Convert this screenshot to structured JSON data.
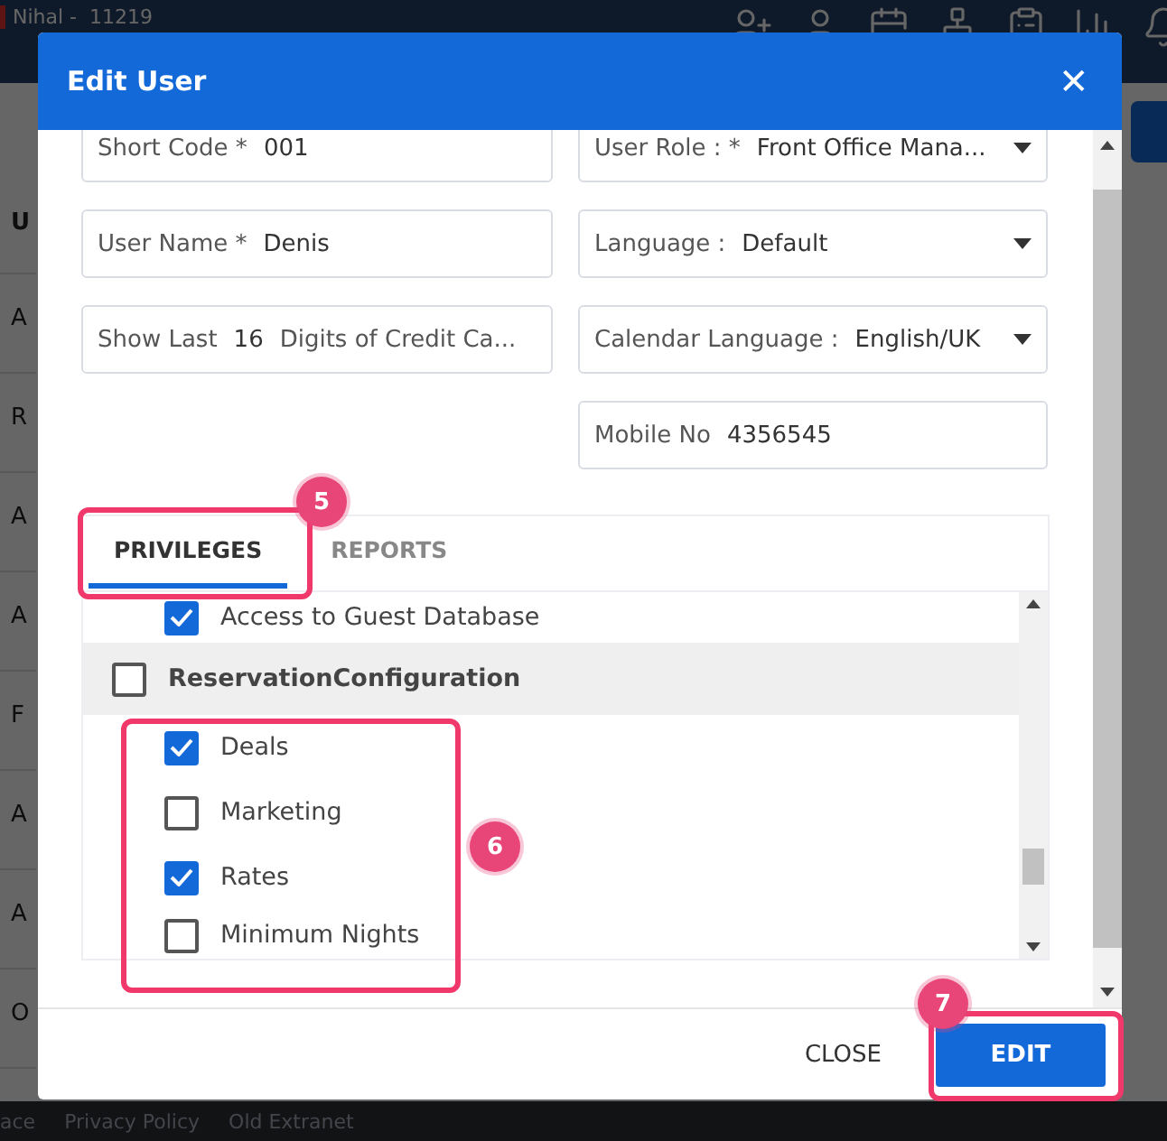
{
  "app": {
    "user": "Nihal -  11219",
    "column_header": "U",
    "row_fragments": [
      "A",
      "R",
      "A",
      "A",
      "F",
      "A",
      "A",
      "O"
    ],
    "footer_links": [
      "ace",
      "Privacy Policy",
      "Old Extranet"
    ]
  },
  "dialog": {
    "title": "Edit User",
    "close_glyph": "✕",
    "left_fields": [
      {
        "kind": "text",
        "label": "Short Code *",
        "value": "001"
      },
      {
        "kind": "text",
        "label": "User Name *",
        "value": "Denis"
      },
      {
        "kind": "digits",
        "label": "Show Last",
        "value": "16",
        "suffix": "Digits of Credit Ca..."
      }
    ],
    "right_fields": [
      {
        "kind": "select",
        "label": "User Role : *",
        "value": "Front Office Mana..."
      },
      {
        "kind": "select",
        "label": "Language :",
        "value": "Default"
      },
      {
        "kind": "select",
        "label": "Calendar Language :",
        "value": "English/UK"
      },
      {
        "kind": "text",
        "label": "Mobile No",
        "value": "4356545"
      }
    ],
    "tabs": [
      {
        "label": "PRIVILEGES",
        "selected": true
      },
      {
        "label": "REPORTS",
        "selected": false
      }
    ],
    "privileges": [
      {
        "kind": "child",
        "label": "Access to Guest Database",
        "checked": true
      },
      {
        "kind": "group",
        "label": "ReservationConfiguration",
        "checked": false
      },
      {
        "kind": "child",
        "label": "Deals",
        "checked": true
      },
      {
        "kind": "child",
        "label": "Marketing",
        "checked": false
      },
      {
        "kind": "child",
        "label": "Rates",
        "checked": true
      },
      {
        "kind": "child",
        "label": "Minimum Nights",
        "checked": false
      }
    ],
    "buttons": [
      {
        "kind": "flat",
        "label": "CLOSE"
      },
      {
        "kind": "primary",
        "label": "EDIT"
      }
    ]
  },
  "callouts": [
    {
      "label": "5"
    },
    {
      "label": "6"
    },
    {
      "label": "7"
    }
  ]
}
